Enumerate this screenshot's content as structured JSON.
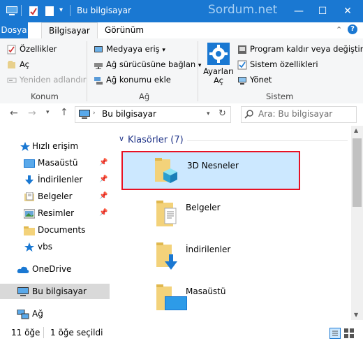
{
  "window": {
    "title": "Bu bilgisayar",
    "watermark": "Sordum.net",
    "minimize_label": "—",
    "maximize_label": "☐",
    "close_label": "✕"
  },
  "ribbon_tabs": {
    "dosya": "Dosya",
    "bilgisayar": "Bilgisayar",
    "gorunum": "Görünüm"
  },
  "ribbon": {
    "konum": {
      "items": [
        "Özellikler",
        "Aç",
        "Yeniden adlandır"
      ],
      "label": "Konum"
    },
    "ag": {
      "items": [
        "Medyaya eriş",
        "Ağ sürücüsüne bağlan",
        "Ağ konumu ekle"
      ],
      "label": "Ağ"
    },
    "sistem": {
      "ayarlari_ac_line1": "Ayarları",
      "ayarlari_ac_line2": "Aç",
      "items": [
        "Program kaldır veya değiştir",
        "Sistem özellikleri",
        "Yönet"
      ],
      "label": "Sistem"
    }
  },
  "navigation": {
    "address": "Bu bilgisayar",
    "search_placeholder": "Ara: Bu bilgisayar"
  },
  "sidebar": {
    "items": [
      {
        "label": "Hızlı erişim",
        "icon": "star-icon"
      },
      {
        "label": "Masaüstü",
        "icon": "desktop-icon",
        "pinned": true
      },
      {
        "label": "İndirilenler",
        "icon": "download-icon",
        "pinned": true
      },
      {
        "label": "Belgeler",
        "icon": "documents-icon",
        "pinned": true
      },
      {
        "label": "Resimler",
        "icon": "pictures-icon",
        "pinned": true
      },
      {
        "label": "Documents",
        "icon": "folder-icon"
      },
      {
        "label": "vbs",
        "icon": "star-icon"
      },
      {
        "label": "OneDrive",
        "icon": "cloud-icon"
      },
      {
        "label": "Bu bilgisayar",
        "icon": "computer-icon",
        "selected": true
      },
      {
        "label": "Ağ",
        "icon": "network-icon"
      }
    ]
  },
  "main": {
    "section_title": "Klasörler (7)",
    "folders": [
      {
        "label": "3D Nesneler",
        "icon": "3d-objects-folder-icon",
        "selected": true
      },
      {
        "label": "Belgeler",
        "icon": "documents-folder-icon"
      },
      {
        "label": "İndirilenler",
        "icon": "downloads-folder-icon"
      },
      {
        "label": "Masaüstü",
        "icon": "desktop-folder-icon"
      }
    ]
  },
  "status": {
    "item_count": "11 öğe",
    "selected": "1 öğe seçildi"
  },
  "colors": {
    "titlebar": "#1a78d2",
    "selection_bg": "#cce8ff",
    "highlight_border": "#e81123",
    "section_title": "#1e3287"
  }
}
